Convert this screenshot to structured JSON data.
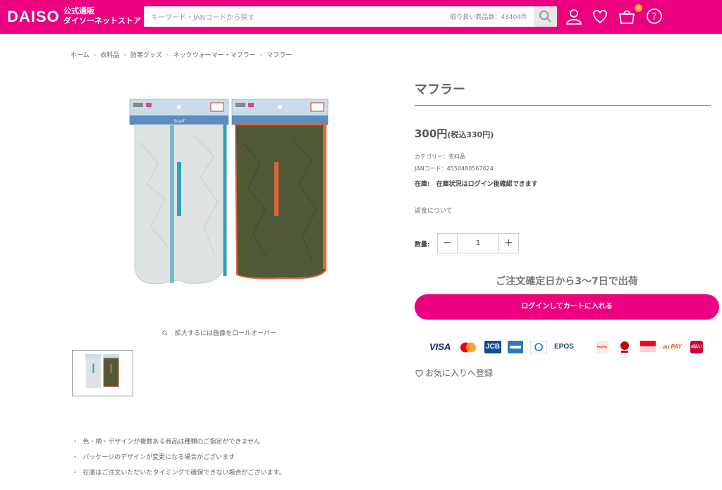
{
  "header": {
    "logo": "DAISO",
    "store_name_line1": "公式通販",
    "store_name_line2": "ダイソーネットストア",
    "search_placeholder": "キーワード・JANコードから探す",
    "product_count": "取り扱い商品数：43404件",
    "cart_count": "0"
  },
  "breadcrumb": [
    "ホーム",
    "衣料品",
    "防寒グッズ",
    "ネックウォーマー・マフラー",
    "マフラー"
  ],
  "gallery": {
    "zoom_hint": "拡大するには画像をロールオーバー",
    "package_label": "Scarf"
  },
  "product": {
    "title": "マフラー",
    "price": "300円",
    "price_tax": "(税込330円)",
    "category": "カテゴリー：衣料品",
    "jan": "JANコード：4550480567624",
    "stock": "在庫:　在庫状況はログイン後確認できます",
    "refund": "返金について",
    "qty_label": "数量:",
    "qty_minus": "−",
    "qty_value": "1",
    "qty_plus": "+",
    "shipping": "ご注文確定日から3〜7日で出荷",
    "cart_button": "ログインしてカートに入れる",
    "favorite": "お気に入りへ登録"
  },
  "payments": {
    "visa": "VISA",
    "jcb": "JCB",
    "epos": "EPOS",
    "paypay": "PayPay",
    "aupay": "au PAY",
    "dpay": "d払い"
  },
  "notes": [
    "色・柄・デザインが複数ある商品は種類のご指定ができません",
    "パッケージのデザインが変更になる場合がございます",
    "在庫はご注文いただいたタイミングで確保できない場合がございます。"
  ],
  "colors": {
    "brand_pink": "#ec0080",
    "scarf_white": "#dde3e2",
    "scarf_green": "#4e5a38",
    "accent_orange": "#e0643a"
  }
}
